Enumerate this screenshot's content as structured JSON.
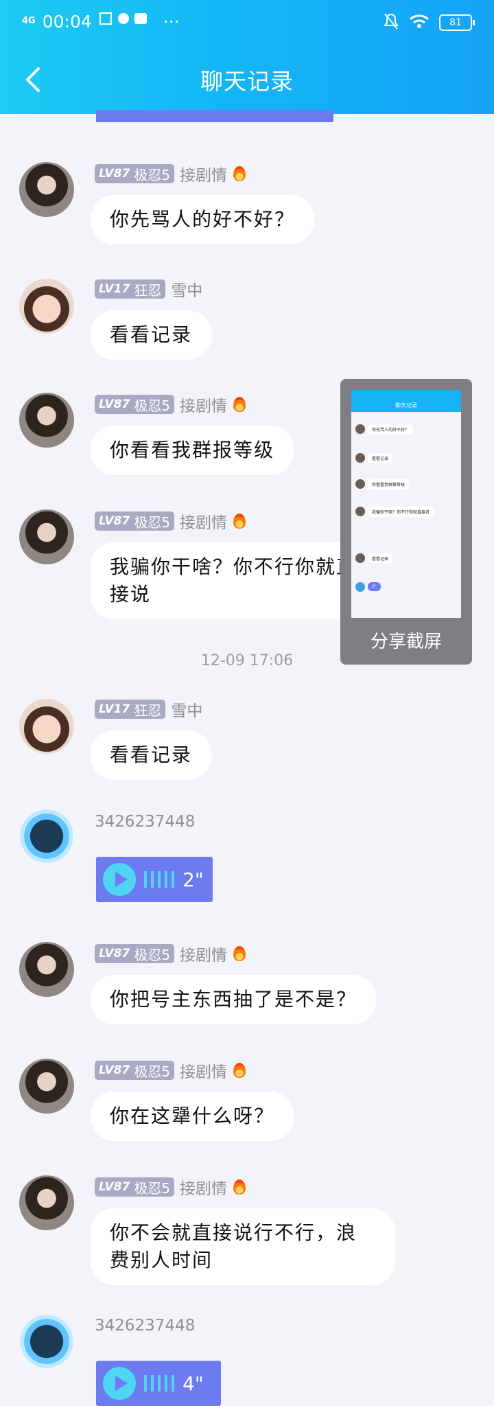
{
  "status_bar": {
    "network": "4G",
    "time": "00:04",
    "more": "···",
    "battery": "81"
  },
  "header": {
    "title": "聊天记录"
  },
  "messages": [
    {
      "level": "LV87",
      "rank": "极忍5",
      "name": "接剧情",
      "text": "你先骂人的好不好？"
    },
    {
      "level": "LV17",
      "rank": "狂忍",
      "name": "雪中",
      "text": "看看记录"
    },
    {
      "level": "LV87",
      "rank": "极忍5",
      "name": "接剧情",
      "text": "你看看我群报等级"
    },
    {
      "level": "LV87",
      "rank": "极忍5",
      "name": "接剧情",
      "text": "我骗你干啥？你不行你就直\n接说"
    },
    {
      "level": "LV17",
      "rank": "狂忍",
      "name": "雪中",
      "text": "看看记录"
    },
    {
      "name": "3426237448",
      "voice": "2\""
    },
    {
      "level": "LV87",
      "rank": "极忍5",
      "name": "接剧情",
      "text": "你把号主东西抽了是不是？"
    },
    {
      "level": "LV87",
      "rank": "极忍5",
      "name": "接剧情",
      "text": "你在这犟什么呀？"
    },
    {
      "level": "LV87",
      "rank": "极忍5",
      "name": "接剧情",
      "text": "你不会就直接说行不行，浪\n费别人时间"
    },
    {
      "name": "3426237448",
      "voice": "4\""
    }
  ],
  "timestamp": "12-09 17:06",
  "share": {
    "label": "分享截屏",
    "thumb_title": "聊天记录"
  },
  "colors": {
    "header": "#16b4f6",
    "voice": "#6c7cf0",
    "badge": "#a7aac3"
  }
}
